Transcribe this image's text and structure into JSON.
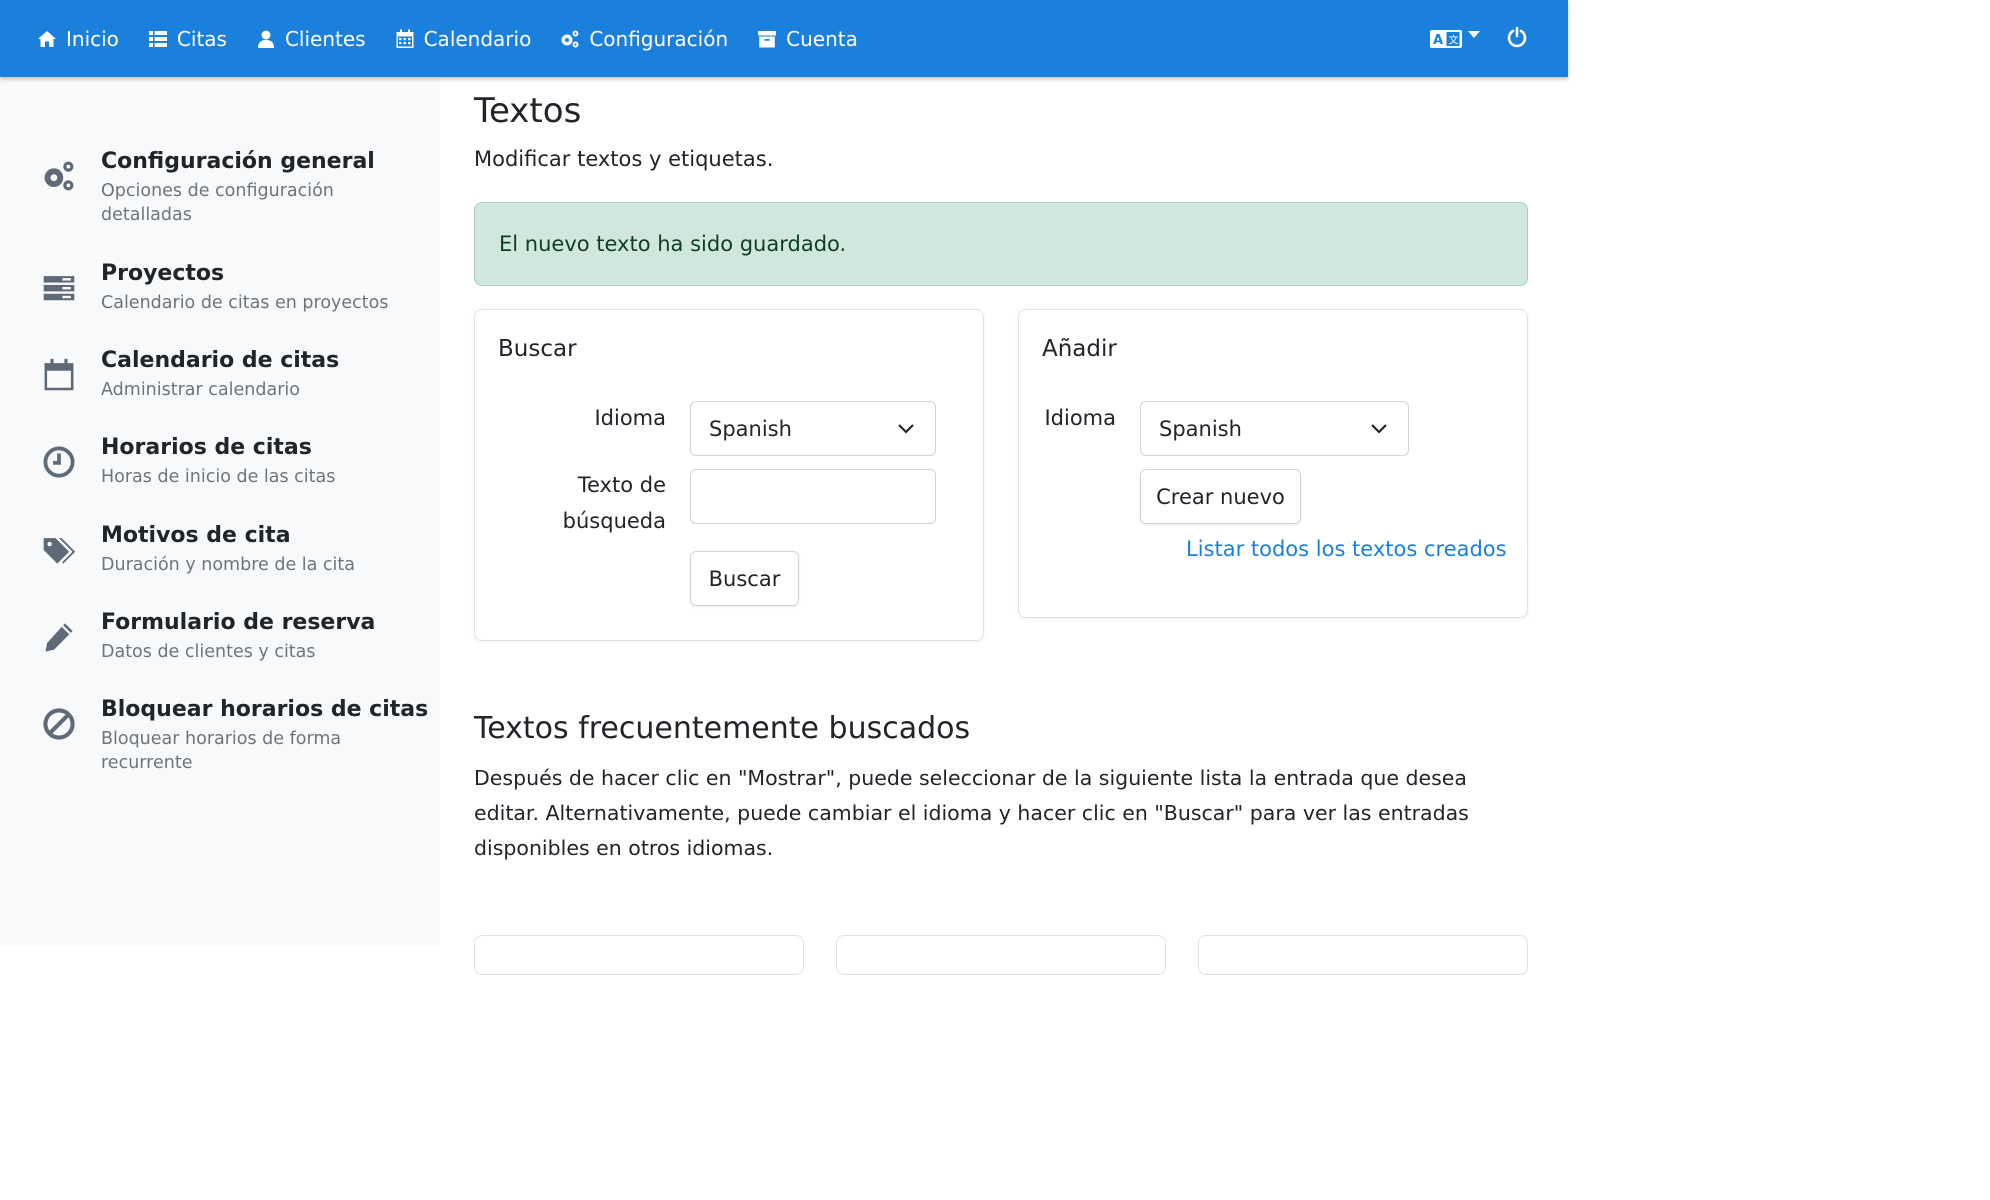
{
  "nav": {
    "items": [
      {
        "label": "Inicio",
        "icon": "home-icon"
      },
      {
        "label": "Citas",
        "icon": "list-icon"
      },
      {
        "label": "Clientes",
        "icon": "user-icon"
      },
      {
        "label": "Calendario",
        "icon": "calendar-icon"
      },
      {
        "label": "Configuración",
        "icon": "gears-icon"
      },
      {
        "label": "Cuenta",
        "icon": "archive-icon"
      }
    ],
    "right_icons": [
      "language-icon",
      "power-icon"
    ]
  },
  "sidebar": {
    "items": [
      {
        "title": "Configuración general",
        "subtitle": "Opciones de configuración detalladas",
        "icon": "gears-icon"
      },
      {
        "title": "Proyectos",
        "subtitle": "Calendario de citas en proyectos",
        "icon": "server-icon"
      },
      {
        "title": "Calendario de citas",
        "subtitle": "Administrar calendario",
        "icon": "calendar-icon"
      },
      {
        "title": "Horarios de citas",
        "subtitle": "Horas de inicio de las citas",
        "icon": "clock-icon"
      },
      {
        "title": "Motivos de cita",
        "subtitle": "Duración y nombre de la cita",
        "icon": "tags-icon"
      },
      {
        "title": "Formulario de reserva",
        "subtitle": "Datos de clientes y citas",
        "icon": "pencil-icon"
      },
      {
        "title": "Bloquear horarios de citas",
        "subtitle": "Bloquear horarios de forma recurrente",
        "icon": "ban-icon"
      }
    ]
  },
  "main": {
    "title": "Textos",
    "subtitle": "Modificar textos y etiquetas.",
    "alert": "El nuevo texto ha sido guardado.",
    "search_card": {
      "title": "Buscar",
      "language_label": "Idioma",
      "language_value": "Spanish",
      "search_text_label_1": "Texto de",
      "search_text_label_2": "búsqueda",
      "search_text_value": "",
      "button": "Buscar"
    },
    "add_card": {
      "title": "Añadir",
      "language_label": "Idioma",
      "language_value": "Spanish",
      "button": "Crear nuevo",
      "link": "Listar todos los textos creados"
    },
    "frequent": {
      "title": "Textos frecuentemente buscados",
      "text": "Después de hacer clic en \"Mostrar\", puede seleccionar de la siguiente lista la entrada que desea editar. Alternativamente, puede cambiar el idioma y hacer clic en \"Buscar\" para ver las entradas disponibles en otros idiomas."
    }
  },
  "colors": {
    "navbar": "#1b7fdc",
    "sidebar_bg": "#f8f9fa",
    "alert_bg": "#d1e7dd",
    "link": "#1b7fdc"
  }
}
